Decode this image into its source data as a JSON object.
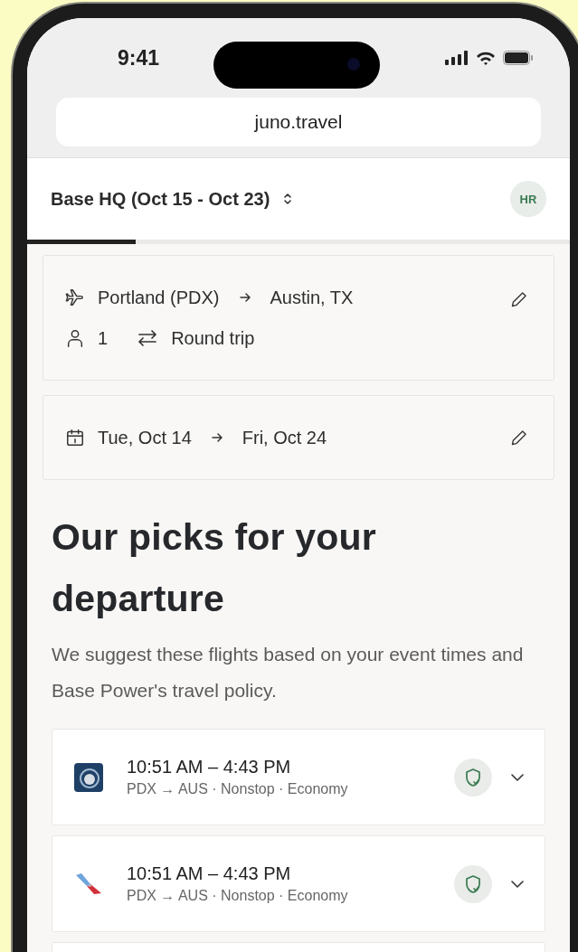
{
  "status_bar": {
    "time": "9:41"
  },
  "browser": {
    "url": "juno.travel"
  },
  "header": {
    "trip_selector": "Base HQ (Oct 15 - Oct 23)",
    "avatar": "HR"
  },
  "progress": {
    "level": 0.2
  },
  "search": {
    "origin": "Portland (PDX)",
    "destination": "Austin, TX",
    "travelers": "1",
    "trip_type": "Round trip"
  },
  "dates": {
    "depart": "Tue, Oct 14",
    "return": "Fri, Oct 24"
  },
  "heading": "Our picks for your departure",
  "description": "We suggest these flights based on your event times and Base Power's travel policy.",
  "flights": [
    {
      "kind": "square",
      "times": "10:51 AM – 4:43 PM",
      "details": "PDX → AUS · Nonstop · Economy"
    },
    {
      "kind": "tail",
      "times": "10:51 AM – 4:43 PM",
      "details": "PDX → AUS · Nonstop · Economy"
    }
  ]
}
